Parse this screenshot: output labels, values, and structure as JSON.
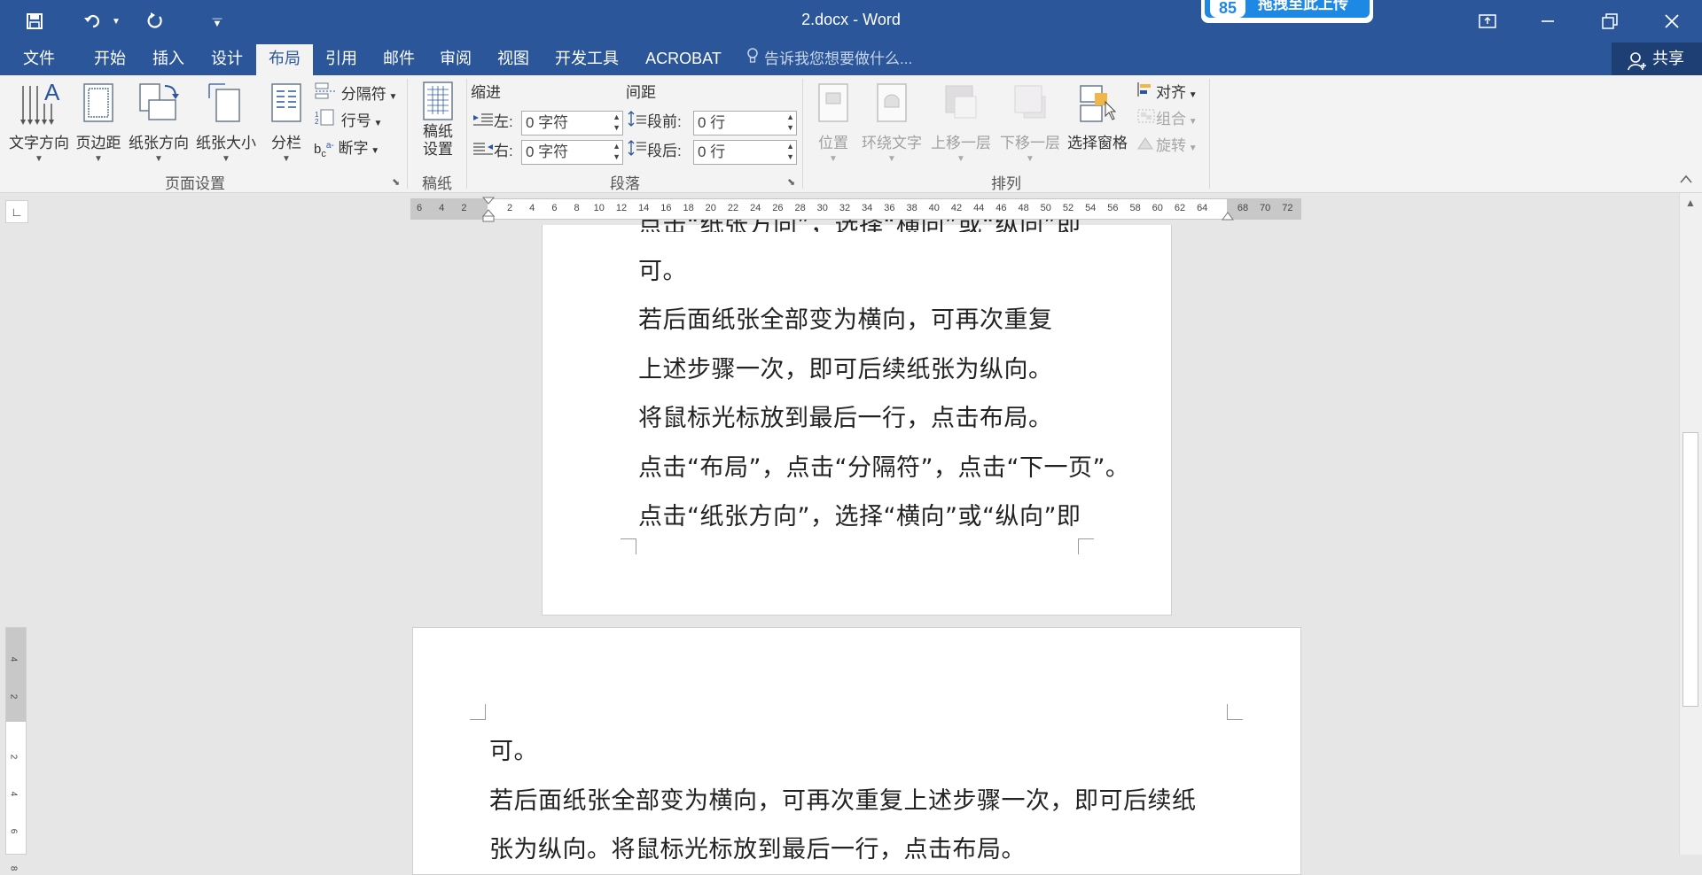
{
  "titlebar": {
    "title": "2.docx - Word",
    "upload_badge": "拖拽至此上传",
    "upload_logo": "85"
  },
  "quick_access": {
    "save_icon": "save-icon",
    "undo_icon": "undo-icon",
    "redo_icon": "redo-icon",
    "customize_icon": "customize-quick-access-icon"
  },
  "menu": {
    "tabs": [
      "文件",
      "开始",
      "插入",
      "设计",
      "布局",
      "引用",
      "邮件",
      "审阅",
      "视图",
      "开发工具",
      "ACROBAT"
    ],
    "active_tab": "布局",
    "tell_me": "告诉我您想要做什么...",
    "share": "共享"
  },
  "ribbon": {
    "page_setup": {
      "text_direction": "文字方向",
      "margins": "页边距",
      "orientation": "纸张方向",
      "size": "纸张大小",
      "columns": "分栏",
      "breaks": "分隔符",
      "line_numbers": "行号",
      "hyphenation": "断字",
      "group_label": "页面设置"
    },
    "manuscript": {
      "settings_line1": "稿纸",
      "settings_line2": "设置",
      "group_label": "稿纸"
    },
    "paragraph": {
      "indent_label": "缩进",
      "spacing_label": "间距",
      "left_label": "左:",
      "right_label": "右:",
      "left_value": "0 字符",
      "right_value": "0 字符",
      "before_label": "段前:",
      "after_label": "段后:",
      "before_value": "0 行",
      "after_value": "0 行",
      "group_label": "段落"
    },
    "arrange": {
      "position": "位置",
      "wrap_text": "环绕文字",
      "bring_forward": "上移一层",
      "send_backward": "下移一层",
      "selection_pane": "选择窗格",
      "align": "对齐",
      "group": "组合",
      "rotate": "旋转",
      "group_label": "排列"
    }
  },
  "ruler": {
    "left_ticks": [
      "6",
      "4",
      "2"
    ],
    "main_ticks": [
      "2",
      "4",
      "6",
      "8",
      "10",
      "12",
      "14",
      "16",
      "18",
      "20",
      "22",
      "24",
      "26",
      "28",
      "30",
      "32",
      "34",
      "36",
      "38",
      "40",
      "42",
      "44",
      "46",
      "48",
      "50",
      "52",
      "54",
      "56",
      "58",
      "60",
      "62",
      "64"
    ],
    "right_ticks": [
      "68",
      "70",
      "72"
    ]
  },
  "document": {
    "page1_lines": [
      "可。",
      "若后面纸张全部变为横向，可再次重复",
      "上述步骤一次，即可后续纸张为纵向。",
      "将鼠标光标放到最后一行，点击布局。",
      "点击“布局”，点击“分隔符”，点击“下一页”。",
      "点击“纸张方向”，选择“横向”或“纵向”即"
    ],
    "page1_partial_top": "点击“纸张方向”，选择“横向”或“纵向”即",
    "page2_lines": [
      "可。",
      "若后面纸张全部变为横向，可再次重复上述步骤一次，即可后续纸",
      "张为纵向。将鼠标光标放到最后一行，点击布局。"
    ]
  },
  "vruler": {
    "ticks": [
      "4",
      "2",
      "2",
      "4",
      "6",
      "8"
    ]
  }
}
